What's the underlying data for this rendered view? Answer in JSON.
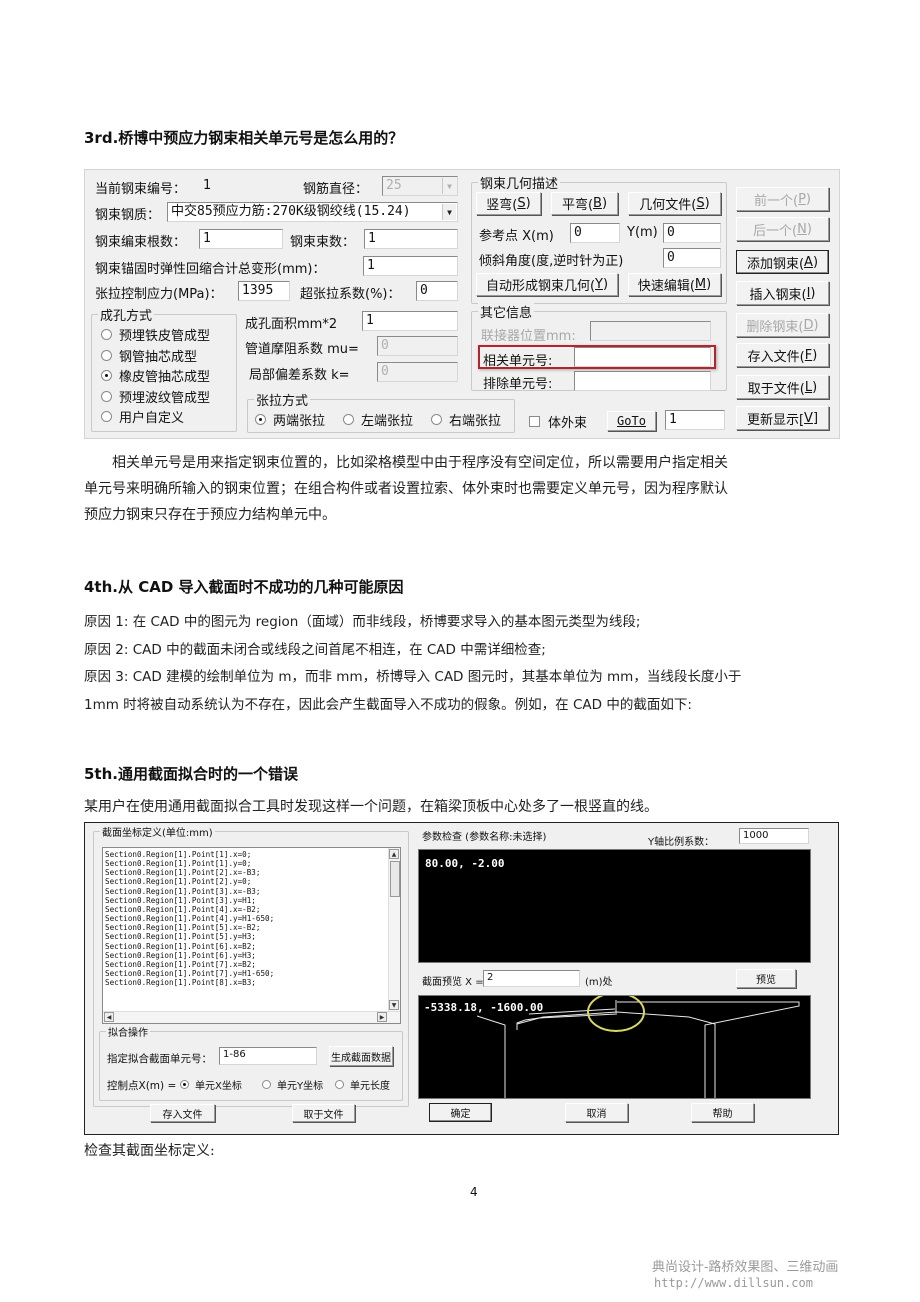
{
  "sections": {
    "s3": {
      "heading": "3rd.桥博中预应力钢束相关单元号是怎么用的？",
      "paragraph_lines": [
        "相关单元号是用来指定钢束位置的，比如梁格模型中由于程序没有空间定位，所以需要用户指定相关",
        "单元号来明确所输入的钢束位置；在组合构件或者设置拉索、体外束时也需要定义单元号，因为程序默认",
        "预应力钢束只存在于预应力结构单元中。"
      ]
    },
    "s4": {
      "heading": "4th.从 CAD 导入截面时不成功的几种可能原因",
      "lines": [
        "原因 1:  在 CAD 中的图元为 region（面域）而非线段，桥博要求导入的基本图元类型为线段;",
        "原因 2:  CAD 中的截面未闭合或线段之间首尾不相连，在 CAD 中需详细检查;",
        "原因 3:  CAD 建模的绘制单位为 m，而非 mm，桥博导入 CAD 图元时，其基本单位为 mm，当线段长度小于",
        "1mm 时将被自动系统认为不存在，因此会产生截面导入不成功的假象。例如，在 CAD 中的截面如下:"
      ]
    },
    "s5": {
      "heading": "5th.通用截面拟合时的一个错误",
      "intro": "某用户在使用通用截面拟合工具时发现这样一个问题，在箱梁顶板中心处多了一根竖直的线。",
      "after": "检查其截面坐标定义:"
    }
  },
  "tendon_dialog": {
    "current_tendon_label": "当前钢束编号：",
    "current_tendon_value": "1",
    "rebar_diameter_label": "钢筋直径：",
    "rebar_diameter_value": "25",
    "material_label": "钢束钢质：",
    "material_value": "中交85预应力筋:270K级钢绞线(15.24)",
    "strands_label": "钢束编束根数：",
    "strands_value": "1",
    "bundles_label": "钢束束数：",
    "bundles_value": "1",
    "anchor_deform_label": "钢束锚固时弹性回缩合计总变形(mm)：",
    "anchor_deform_value": "1",
    "control_stress_label": "张拉控制应力(MPa)：",
    "control_stress_value": "1395",
    "over_tension_label": "超张拉系数(%)：",
    "over_tension_value": "0",
    "duct_group": {
      "title": "成孔方式",
      "options": [
        "预埋铁皮管成型",
        "钢管抽芯成型",
        "橡皮管抽芯成型",
        "预埋波纹管成型",
        "用户自定义"
      ],
      "selected_index": 2
    },
    "duct_area_label": "成孔面积mm*2",
    "duct_area_value": "1",
    "friction_label": "管道摩阻系数  mu=",
    "friction_value": "0",
    "wobble_label": "局部偏差系数  k=",
    "wobble_value": "0",
    "tension_group": {
      "title": "张拉方式",
      "options": [
        "两端张拉",
        "左端张拉",
        "右端张拉"
      ],
      "selected_index": 0
    },
    "geometry_group": {
      "title": "钢束几何描述",
      "vertical_btn": "竖弯(",
      "vertical_key": "S",
      "horizontal_btn": "平弯(",
      "horizontal_key": "B",
      "geomfile_btn": "几何文件(",
      "geomfile_key": "S",
      "ref_point_label": "参考点 X(m)",
      "ref_x_value": "0",
      "ref_y_label": "Y(m)",
      "ref_y_value": "0",
      "angle_label": "倾斜角度(度,逆时针为正)",
      "angle_value": "0",
      "auto_btn": "自动形成钢束几何(",
      "auto_key": "Y",
      "quick_edit_btn": "快速编辑(",
      "quick_edit_key": "M"
    },
    "other_group": {
      "title": "其它信息",
      "coupler_label": "联接器位置mm:",
      "coupler_value": "",
      "related_label": "相关单元号:",
      "related_value": "",
      "exclude_label": "排除单元号:",
      "exclude_value": ""
    },
    "external_label": "体外束",
    "external_checked": false,
    "goto_btn": "GoTo",
    "goto_value": "1",
    "side_buttons": [
      {
        "text": "前一个(",
        "key": "P",
        "close": ")",
        "enabled": false,
        "default": false
      },
      {
        "text": "后一个(",
        "key": "N",
        "close": ")",
        "enabled": false,
        "default": false
      },
      {
        "text": "添加钢束(",
        "key": "A",
        "close": ")",
        "enabled": true,
        "default": true
      },
      {
        "text": "插入钢束(",
        "key": "I",
        "close": ")",
        "enabled": true,
        "default": false
      },
      {
        "text": "删除钢束(",
        "key": "D",
        "close": ")",
        "enabled": false,
        "default": false
      },
      {
        "text": "存入文件(",
        "key": "F",
        "close": ")",
        "enabled": true,
        "default": false
      },
      {
        "text": "取于文件(",
        "key": "L",
        "close": ")",
        "enabled": true,
        "default": false
      },
      {
        "text": "更新显示[",
        "key": "V",
        "close": "]",
        "enabled": true,
        "default": false
      }
    ],
    "highlight_color": "#b5242a"
  },
  "section_fit_dialog": {
    "coord_group_title": "截面坐标定义(单位:mm)",
    "code_lines": [
      "Section0.Region[1].Point[1].x=0;",
      "Section0.Region[1].Point[1].y=0;",
      "Section0.Region[1].Point[2].x=-B3;",
      "Section0.Region[1].Point[2].y=0;",
      "Section0.Region[1].Point[3].x=-B3;",
      "Section0.Region[1].Point[3].y=H1;",
      "Section0.Region[1].Point[4].x=-B2;",
      "Section0.Region[1].Point[4].y=H1-650;",
      "Section0.Region[1].Point[5].x=-B2;",
      "Section0.Region[1].Point[5].y=H3;",
      "Section0.Region[1].Point[6].x=B2;",
      "Section0.Region[1].Point[6].y=H3;",
      "Section0.Region[1].Point[7].x=B2;",
      "Section0.Region[1].Point[7].y=H1-650;",
      "Section0.Region[1].Point[8].x=B3;"
    ],
    "fit_group_title": "拟合操作",
    "fit_elements_label": "指定拟合截面单元号：",
    "fit_elements_value": "1-86",
    "generate_btn": "生成截面数据",
    "control_point_label": "控制点X(m) =",
    "control_options": [
      "单元X坐标",
      "单元Y坐标",
      "单元长度"
    ],
    "control_selected_index": 0,
    "save_btn": "存入文件",
    "load_btn": "取于文件",
    "param_check_label": "参数检查 (参数名称:未选择)",
    "y_scale_label": "Y轴比例系数：",
    "y_scale_value": "1000",
    "param_coord": "80.00, -2.00",
    "preview_label": "截面预览  X =",
    "preview_x_value": "2",
    "preview_unit": "(m)处",
    "preview_btn": "预览",
    "preview_coord": "-5338.18, -1600.00",
    "ok_btn": "确定",
    "cancel_btn": "取消",
    "help_btn": "帮助",
    "annotation_color": "#d8d860"
  },
  "footer": {
    "page_number": "4",
    "watermark_line1": "典尚设计-路桥效果图、三维动画",
    "watermark_line2": "http://www.dillsun.com"
  }
}
